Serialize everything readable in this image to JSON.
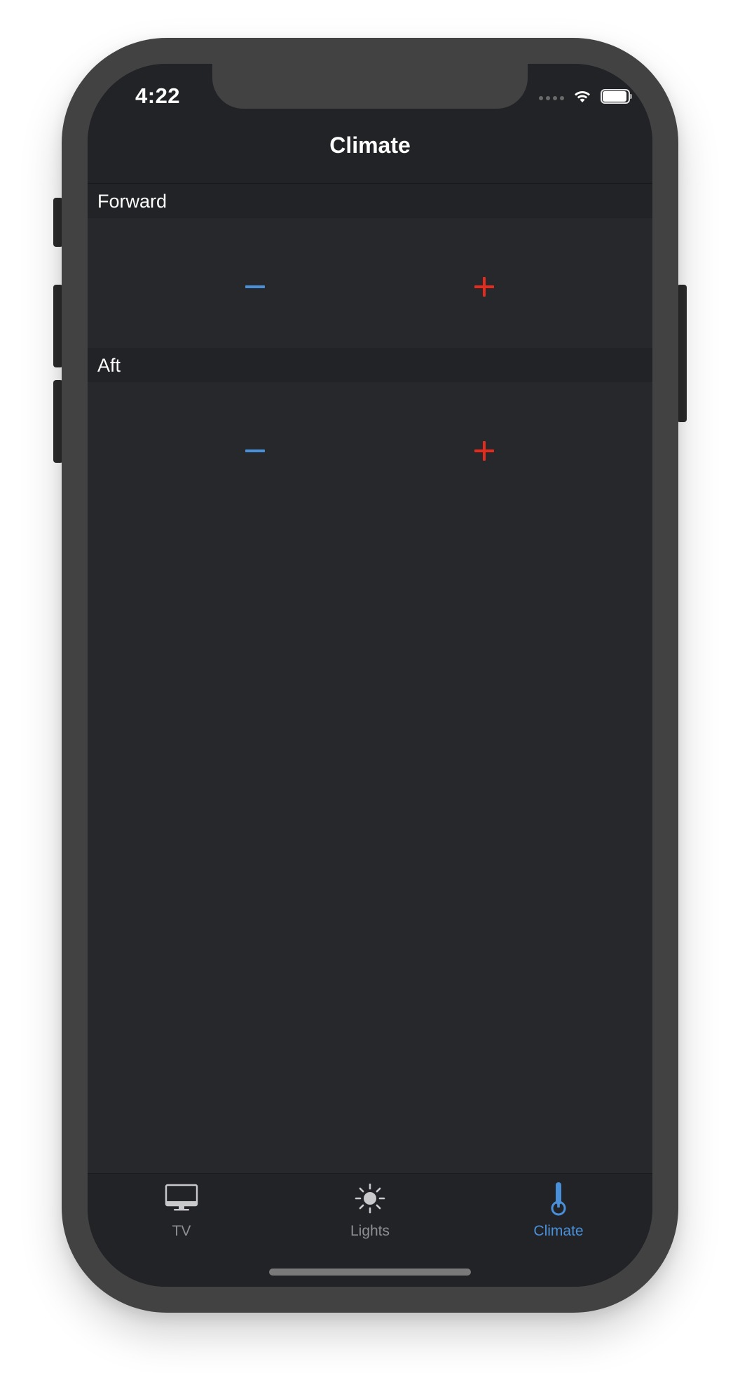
{
  "status_bar": {
    "time": "4:22"
  },
  "nav": {
    "title": "Climate"
  },
  "sections": [
    {
      "header": "Forward",
      "decrease_label": "−",
      "increase_label": "+"
    },
    {
      "header": "Aft",
      "decrease_label": "−",
      "increase_label": "+"
    }
  ],
  "tab_bar": {
    "selected": "Climate",
    "tabs": [
      {
        "label": "TV",
        "icon": "tv-icon"
      },
      {
        "label": "Lights",
        "icon": "sun-icon"
      },
      {
        "label": "Climate",
        "icon": "thermometer-icon"
      }
    ]
  },
  "colors": {
    "background": "#26282c",
    "bar_background": "#222326",
    "accent_blue": "#4a90d9",
    "accent_red": "#e32b1e",
    "inactive_tab": "#8e8e93"
  }
}
